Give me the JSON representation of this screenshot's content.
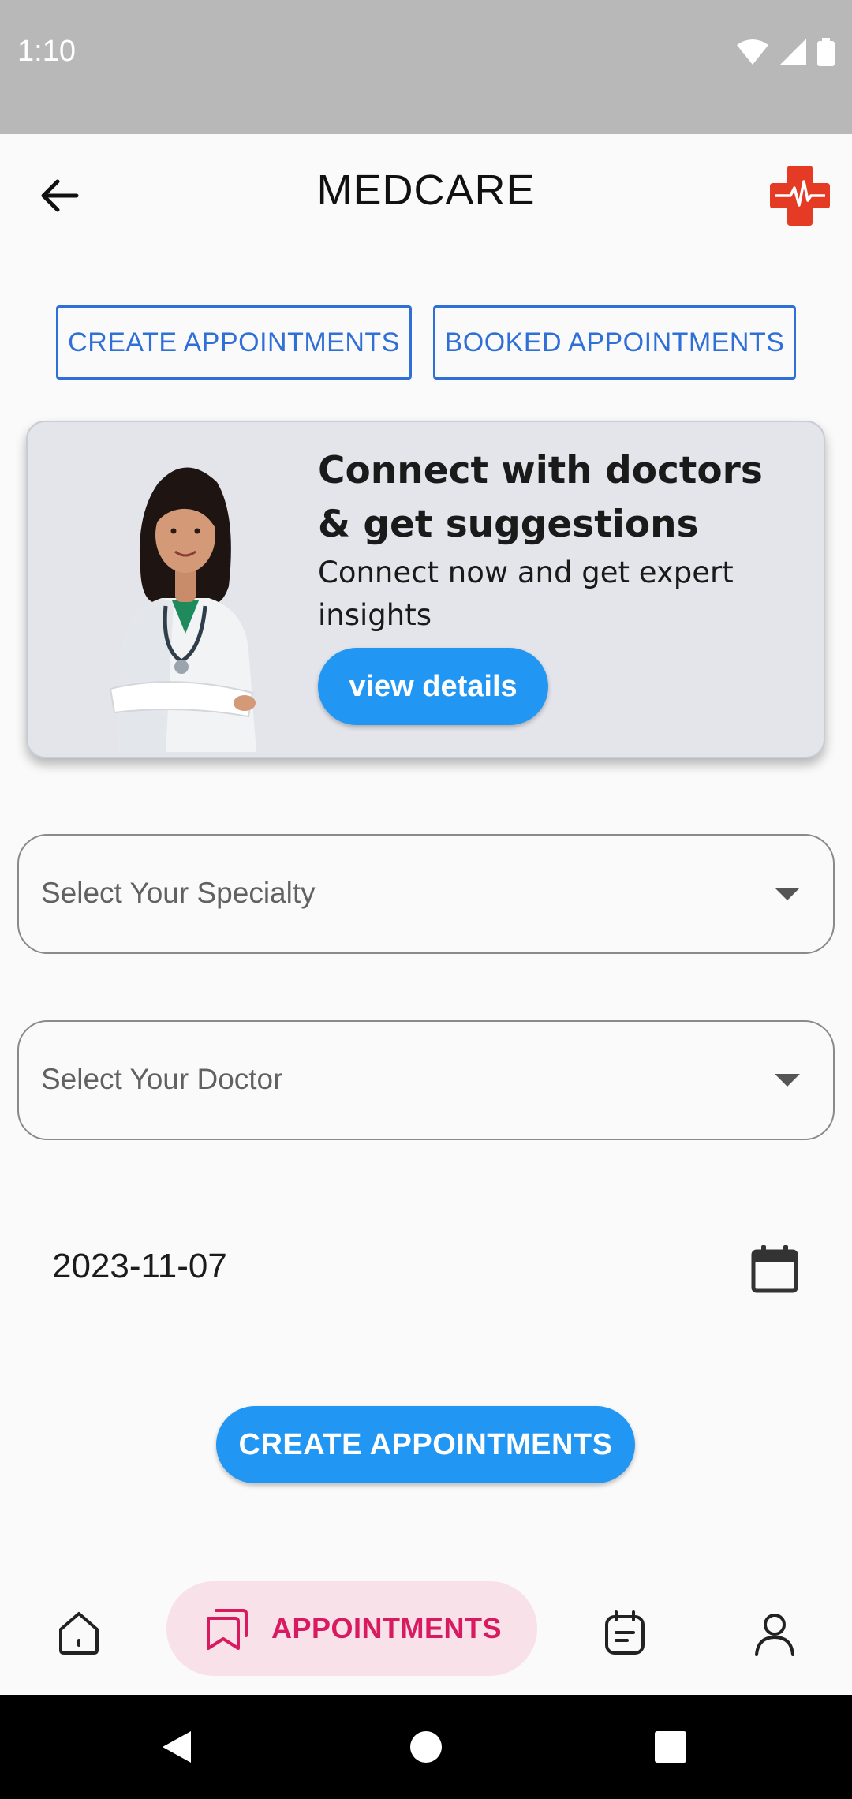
{
  "status_bar": {
    "time": "1:10"
  },
  "app_bar": {
    "title": "MEDCARE"
  },
  "tabs": {
    "create_label": "CREATE APPOINTMENTS",
    "booked_label": "BOOKED APPOINTMENTS"
  },
  "banner": {
    "title": "Connect with doctors & get suggestions",
    "subtitle": "Connect now and get expert insights",
    "button_label": "view details"
  },
  "form": {
    "specialty_placeholder": "Select Your Specialty",
    "doctor_placeholder": "Select Your Doctor",
    "date_value": "2023-11-07",
    "submit_label": "CREATE APPOINTMENTS"
  },
  "bottom_nav": {
    "items": [
      {
        "icon": "home-icon",
        "label": ""
      },
      {
        "icon": "appointments-icon",
        "label": "APPOINTMENTS",
        "active": true
      },
      {
        "icon": "records-icon",
        "label": ""
      },
      {
        "icon": "profile-icon",
        "label": ""
      }
    ]
  },
  "colors": {
    "accent": "#2196f3",
    "outline_blue": "#2f6fd8",
    "active_nav_bg": "#f8e1e8",
    "active_nav_fg": "#d81b60",
    "logo_red": "#e53a24"
  }
}
